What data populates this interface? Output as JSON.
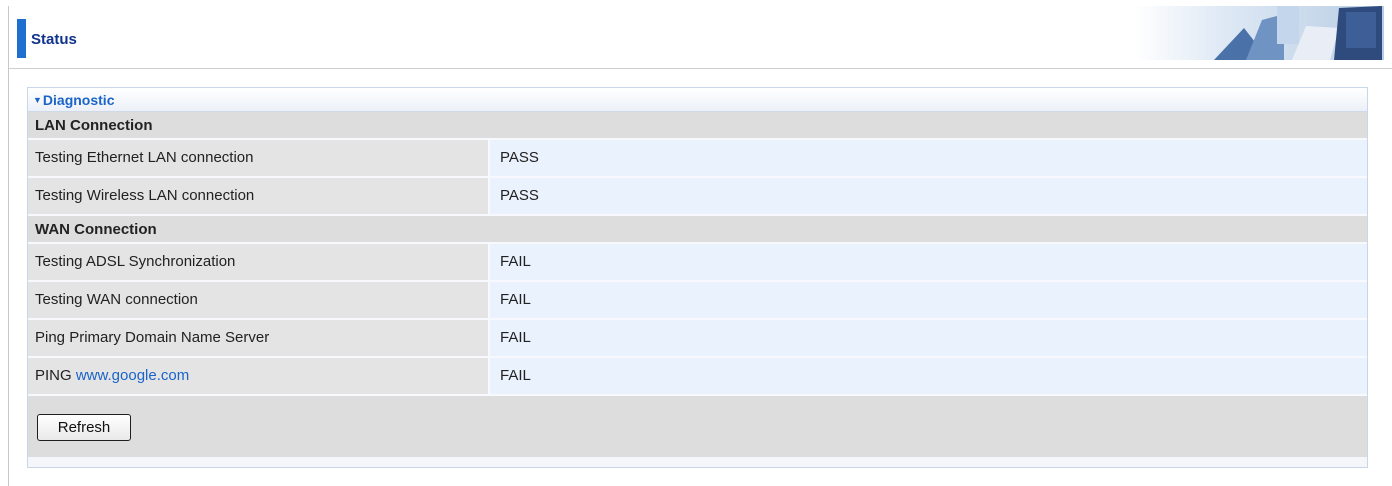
{
  "header": {
    "title": "Status"
  },
  "panel": {
    "title": "Diagnostic"
  },
  "sections": [
    {
      "title": "LAN Connection",
      "rows": [
        {
          "label": "Testing Ethernet LAN connection",
          "value": "PASS"
        },
        {
          "label": "Testing Wireless LAN connection",
          "value": "PASS"
        }
      ]
    },
    {
      "title": "WAN Connection",
      "rows": [
        {
          "label": "Testing ADSL Synchronization",
          "value": "FAIL"
        },
        {
          "label": "Testing WAN connection",
          "value": "FAIL"
        },
        {
          "label": "Ping Primary Domain Name Server",
          "value": "FAIL"
        },
        {
          "label_prefix": "PING ",
          "label_link": "www.google.com",
          "value": "FAIL"
        }
      ]
    }
  ],
  "footer": {
    "refresh_label": "Refresh"
  },
  "colors": {
    "accent": "#1f6fd0",
    "title_text": "#10338e",
    "link": "#1b64c8"
  }
}
